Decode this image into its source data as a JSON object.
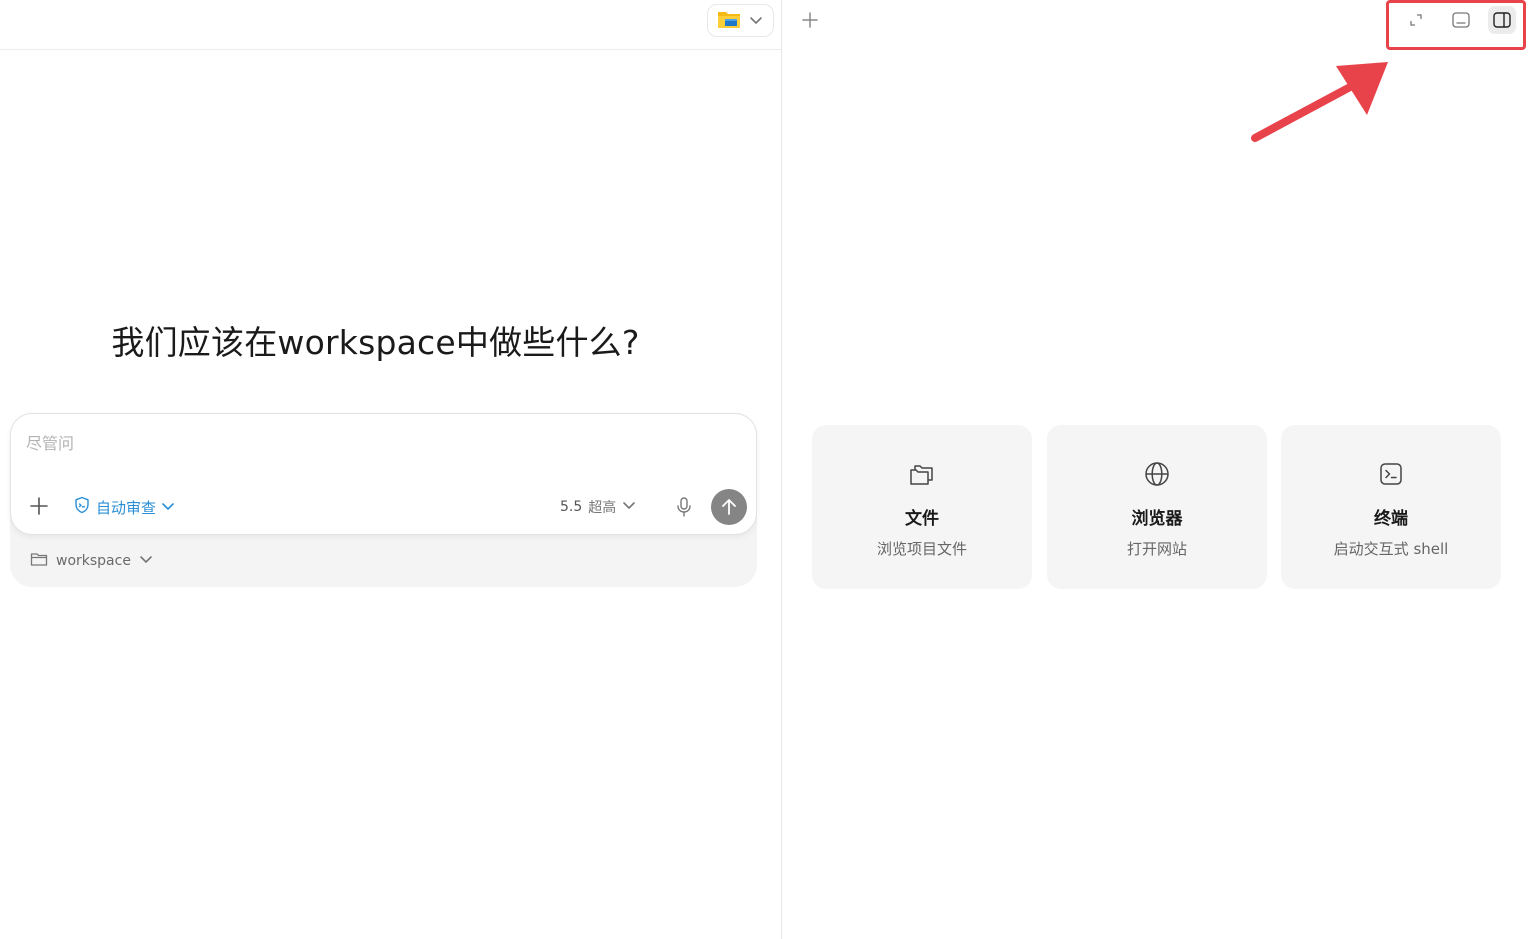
{
  "left_pane": {
    "heading": "我们应该在workspace中做些什么?",
    "composer": {
      "placeholder": "尽管问",
      "review_mode": "自动审查",
      "model": "5.5",
      "quality": "超高"
    },
    "workspace_selector": "workspace"
  },
  "right_pane": {
    "cards": [
      {
        "icon": "folders-icon",
        "title": "文件",
        "subtitle": "浏览项目文件"
      },
      {
        "icon": "globe-icon",
        "title": "浏览器",
        "subtitle": "打开网站"
      },
      {
        "icon": "terminal-icon",
        "title": "终端",
        "subtitle": "启动交互式 shell"
      }
    ],
    "view_controls": [
      "expand-icon",
      "bottom-panel-icon",
      "side-panel-icon"
    ]
  },
  "colors": {
    "accent_blue": "#2b8fd6",
    "highlight_red": "#e8434a",
    "send_button": "#858585",
    "card_bg": "#f5f5f5"
  }
}
